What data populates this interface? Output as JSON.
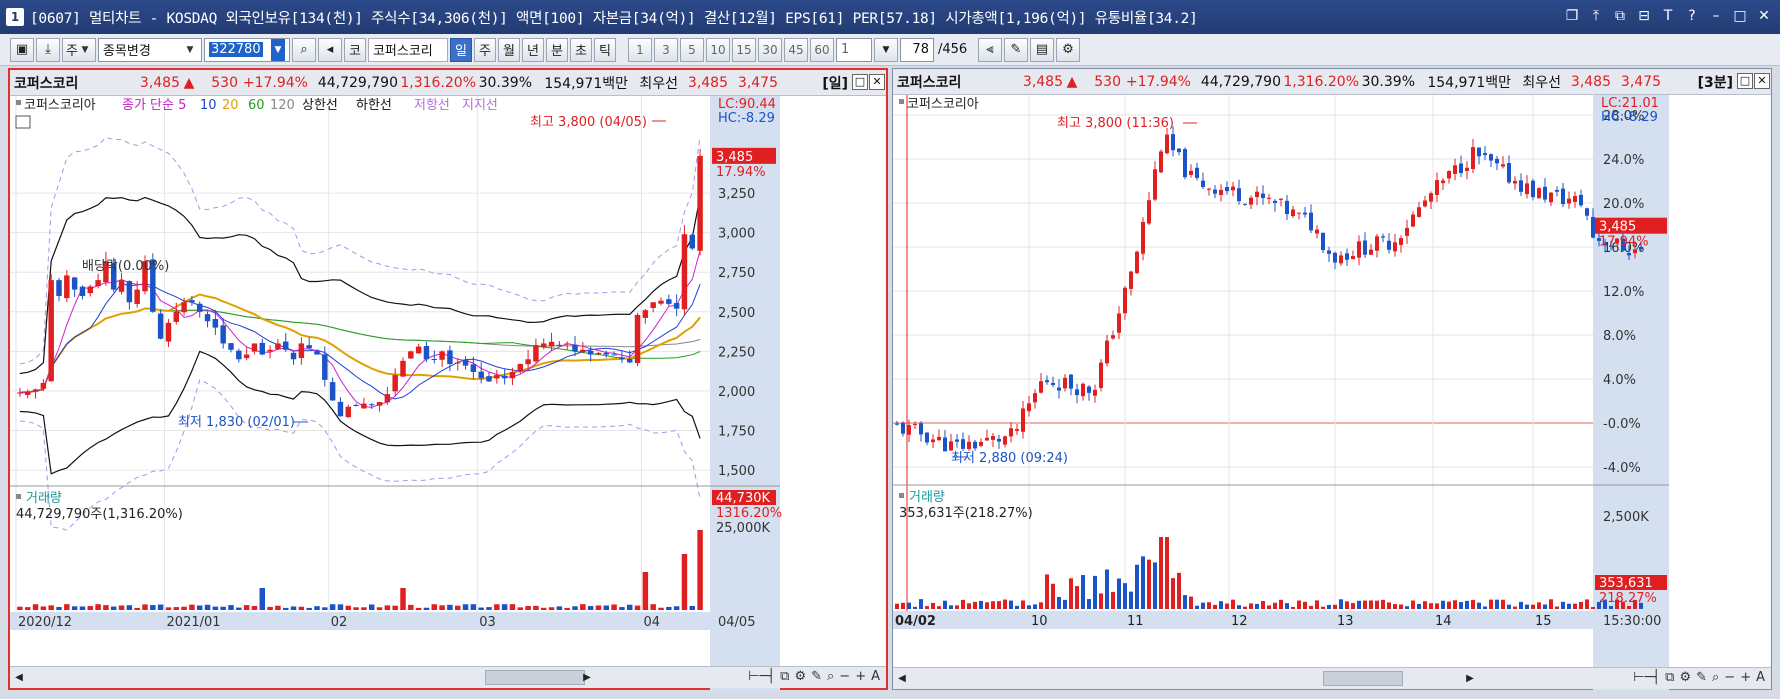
{
  "window": {
    "app_number": "1",
    "title": "[0607] 멀티차트 - KOSDAQ 외국인보유[134(천)] 주식수[34,306(천)] 액면[100] 자본금[34(억)] 결산[12월] EPS[61] PER[57.18] 시가총액[1,196(억)] 유통비율[34.2]",
    "buttons": [
      "❐",
      "⤒",
      "⧉",
      "⊟",
      "T",
      "?",
      "–",
      "□",
      "✕"
    ]
  },
  "toolbar": {
    "period_label": "주",
    "stock_select": "종목변경",
    "code_value": "322780",
    "stock_short": "코",
    "stock_name": "코퍼스코리",
    "periods": [
      "일",
      "주",
      "월",
      "년",
      "분",
      "초",
      "틱"
    ],
    "active_period": "일",
    "intervals": [
      "1",
      "3",
      "5",
      "10",
      "15",
      "30",
      "45",
      "60"
    ],
    "interval_value": "1",
    "page_current": "78",
    "page_total": "/456"
  },
  "left_panel": {
    "name": "코퍼스코리",
    "price": "3,485",
    "arrow": "▲",
    "change": "530",
    "change_pct": "+17.94%",
    "volume": "44,729,790",
    "volume_pct": "1,316.20%",
    "turnover": "30.39%",
    "amount": "154,971백만",
    "bid_label": "최우선",
    "ask": "3,485",
    "bid": "3,475",
    "period_tag": "[일]",
    "legend": {
      "name": "코퍼스코리아",
      "ma_label": "종가 단순 5",
      "ma_values": [
        "10",
        "20",
        "60",
        "120"
      ],
      "ma_colors": [
        "#2040d0",
        "#e0a000",
        "#20a020",
        "#888888"
      ],
      "upper_limit": "상한선",
      "lower_limit": "하한선",
      "resistance": "저항선",
      "support": "지지선"
    },
    "lc": "LC:90.44",
    "hc": "HC:-8.29",
    "high_label": "최고 3,800 (04/05)",
    "low_label": "최저 1,830 (02/01)",
    "dividend_label": "배당락(0.00%)",
    "price_tag": "3,485",
    "pct_tag": "17.94%",
    "y_ticks": [
      "3,250",
      "3,000",
      "2,750",
      "2,500",
      "2,250",
      "2,000",
      "1,750",
      "1,500"
    ],
    "volume_title": "거래량",
    "volume_text": "44,729,790주(1,316.20%)",
    "vol_tag": "44,730K",
    "vol_pct_tag": "1316.20%",
    "vol_tick": "25,000K",
    "x_ticks": [
      "2020/12",
      "2021/01",
      "02",
      "03",
      "04"
    ],
    "x_right": "04/05"
  },
  "right_panel": {
    "name": "코퍼스코리",
    "price": "3,485",
    "arrow": "▲",
    "change": "530",
    "change_pct": "+17.94%",
    "volume": "44,729,790",
    "volume_pct": "1,316.20%",
    "turnover": "30.39%",
    "amount": "154,971백만",
    "bid_label": "최우선",
    "ask": "3,485",
    "bid": "3,475",
    "period_tag": "[3분]",
    "legend_name": "코퍼스코리아",
    "lc": "LC:21.01",
    "hc": "HC:-8.29",
    "high_label": "최고 3,800 (11:36)",
    "low_label": "최저 2,880 (09:24)",
    "price_tag": "3,485",
    "pct_tag": "17.94%",
    "y_ticks": [
      "28.0%",
      "24.0%",
      "20.0%",
      "16.0%",
      "12.0%",
      "8.0%",
      "4.0%",
      "-0.0%",
      "-4.0%"
    ],
    "volume_title": "거래량",
    "volume_text": "353,631주(218.27%)",
    "vol_tick": "2,500K",
    "vol_tag": "353,631",
    "vol_pct_tag": "218.27%",
    "x_ticks": [
      "04/02",
      "10",
      "11",
      "12",
      "13",
      "14",
      "15"
    ],
    "x_right": "15:30:00"
  },
  "chart_data": [
    {
      "type": "candlestick",
      "title": "코퍼스코리아 일봉",
      "y_range": [
        1450,
        3800
      ],
      "high": 3800,
      "low": 1830,
      "close": [
        1990,
        1995,
        2010,
        2050,
        2700,
        2600,
        2730,
        2640,
        2600,
        2660,
        2700,
        2820,
        2640,
        2700,
        2560,
        2640,
        2820,
        2500,
        2330,
        2430,
        2500,
        2560,
        2560,
        2500,
        2440,
        2400,
        2300,
        2260,
        2200,
        2230,
        2300,
        2230,
        2260,
        2300,
        2260,
        2200,
        2300,
        2270,
        2230,
        2070,
        1940,
        1840,
        1900,
        1910,
        1920,
        1910,
        1930,
        1980,
        2100,
        2190,
        2250,
        2280,
        2200,
        2200,
        2250,
        2170,
        2180,
        2160,
        2120,
        2080,
        2060,
        2100,
        2080,
        2120,
        2170,
        2200,
        2290,
        2300,
        2310,
        2290,
        2300,
        2250,
        2260,
        2230,
        2240,
        2230,
        2230,
        2200,
        2180,
        2480,
        2510,
        2560,
        2570,
        2550,
        2520,
        2990,
        2900,
        3485
      ]
    },
    {
      "type": "candlestick",
      "title": "코퍼스코리아 3분봉",
      "y_unit": "%",
      "y_range": [
        -4.0,
        28.0
      ],
      "high": 3800,
      "low": 2880
    }
  ]
}
